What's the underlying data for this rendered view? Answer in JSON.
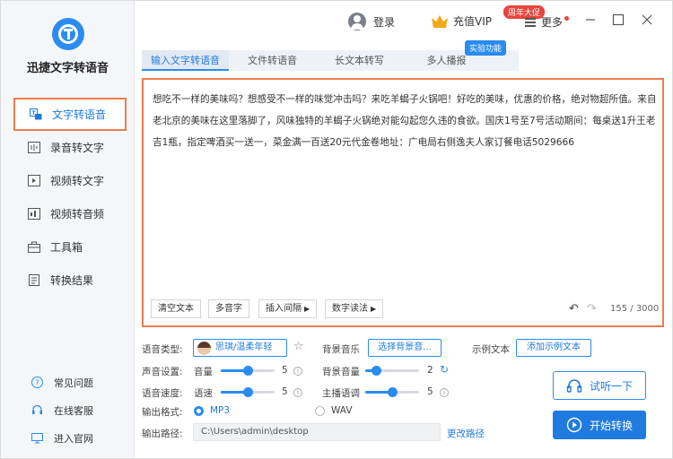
{
  "app": {
    "title": "迅捷文字转语音"
  },
  "colors": {
    "accent": "#1f7be0",
    "highlight_border": "#ee7c4f",
    "badge_red": "#e8453c"
  },
  "sidebar": {
    "items": [
      {
        "label": "文字转语音",
        "icon": "text-to-speech-icon",
        "active": true
      },
      {
        "label": "录音转文字",
        "icon": "recording-icon",
        "active": false
      },
      {
        "label": "视频转文字",
        "icon": "video-text-icon",
        "active": false
      },
      {
        "label": "视频转音频",
        "icon": "video-audio-icon",
        "active": false
      },
      {
        "label": "工具箱",
        "icon": "toolbox-icon",
        "active": false
      },
      {
        "label": "转换结果",
        "icon": "result-icon",
        "active": false
      }
    ],
    "footer": [
      {
        "label": "常见问题",
        "icon": "help-icon"
      },
      {
        "label": "在线客服",
        "icon": "headset-icon"
      },
      {
        "label": "进入官网",
        "icon": "monitor-icon"
      }
    ]
  },
  "topbar": {
    "login": "登录",
    "vip": "充值VIP",
    "vip_badge": "周年大促",
    "more": "更多"
  },
  "tabs": [
    {
      "label": "输入文字转语音",
      "active": true
    },
    {
      "label": "文件转语音",
      "active": false
    },
    {
      "label": "长文本转写",
      "active": false
    },
    {
      "label": "多人播报",
      "active": false
    }
  ],
  "experimental_badge": "实验功能",
  "editor": {
    "text": "想吃不一样的美味吗？想感受不一样的味觉冲击吗？来吃羊蝎子火锅吧！好吃的美味，优惠的价格，绝对物超所值。来自老北京的美味在这里落脚了，风味独特的羊蝎子火锅绝对能勾起您久违的食欲。国庆1号至7号活动期间：每桌送1升王老吉1瓶，指定啤酒买一送一，菜金满一百送20元代金卷地址：广电局右侧逸夫人家订餐电话5029666",
    "buttons": {
      "clear": "清空文本",
      "polyphone": "多音字",
      "insert_pause": "插入间隔",
      "number_reading": "数字读法"
    },
    "count": "155 / 3000"
  },
  "settings": {
    "voice_type_label": "语音类型:",
    "voice_name": "思琪/温柔年轻",
    "bg_music_label": "背景音乐",
    "bg_music_button": "选择背景音...",
    "sample_text_label": "示例文本",
    "sample_text_button": "添加示例文本",
    "sound_settings_label": "声音设置:",
    "volume_label": "音量",
    "volume_value": "5",
    "volume_level": 0.5,
    "bg_volume_label": "背景音量",
    "bg_volume_value": "2",
    "bg_volume_level": 0.2,
    "speed_section_label": "语音速度:",
    "speed_label": "语速",
    "speed_value": "5",
    "speed_level": 0.5,
    "host_tone_label": "主播语调",
    "host_tone_value": "5",
    "host_tone_level": 0.5,
    "format_label": "输出格式:",
    "format_mp3": "MP3",
    "format_wav": "WAV",
    "selected_format": "MP3",
    "path_label": "输出路径:",
    "path_value": "C:\\Users\\admin\\desktop",
    "change_path": "更改路径"
  },
  "actions": {
    "listen": "试听一下",
    "start": "开始转换"
  }
}
